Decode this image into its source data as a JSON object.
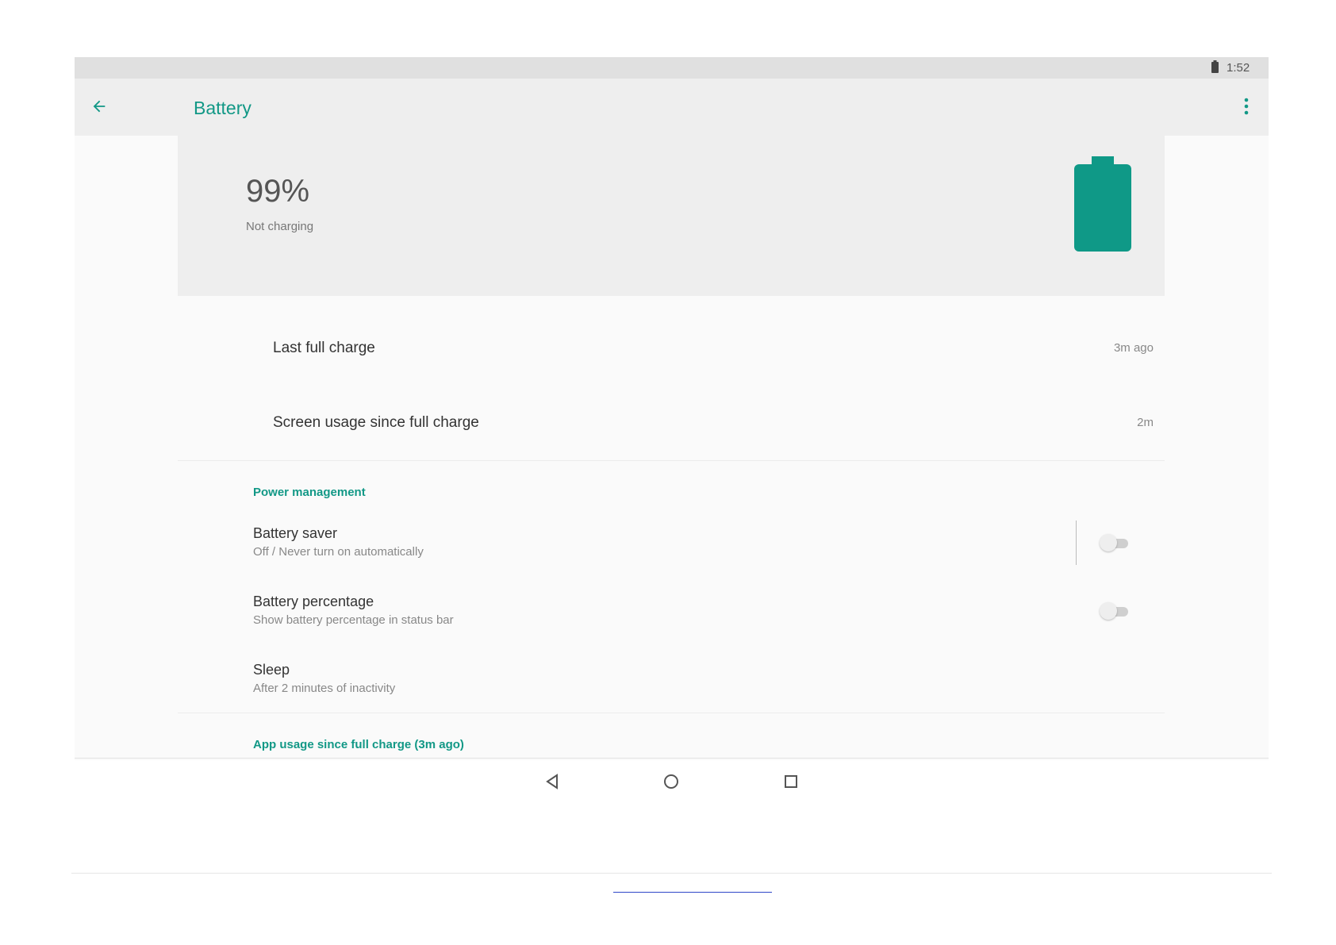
{
  "status_bar": {
    "time": "1:52",
    "battery_icon": "battery-full-icon"
  },
  "app_bar": {
    "title": "Battery",
    "back_icon": "arrow-left-icon",
    "menu_icon": "more-vert-icon"
  },
  "summary": {
    "percentage": "99%",
    "status": "Not charging",
    "battery_icon": "battery-large-icon"
  },
  "usage": [
    {
      "label": "Last full charge",
      "value": "3m ago"
    },
    {
      "label": "Screen usage since full charge",
      "value": "2m"
    }
  ],
  "power_management": {
    "header": "Power management",
    "items": [
      {
        "title": "Battery saver",
        "subtitle": "Off / Never turn on automatically",
        "toggle": false
      },
      {
        "title": "Battery percentage",
        "subtitle": "Show battery percentage in status bar",
        "toggle": false
      },
      {
        "title": "Sleep",
        "subtitle": "After 2 minutes of inactivity"
      }
    ]
  },
  "app_usage": {
    "header": "App usage since full charge (3m ago)"
  },
  "nav_bar": {
    "back_icon": "nav-back-icon",
    "home_icon": "nav-home-icon",
    "recents_icon": "nav-recents-icon"
  },
  "colors": {
    "accent": "#129886",
    "battery": "#0f9987",
    "statusbar": "#e0e0e0",
    "appbar": "#eeeeee"
  }
}
